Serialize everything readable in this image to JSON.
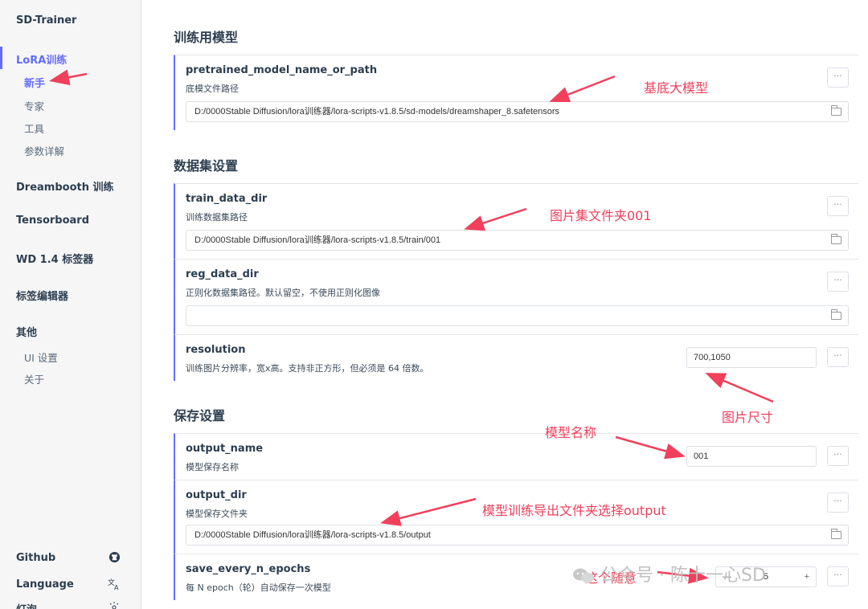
{
  "sidebar": {
    "app_title": "SD-Trainer",
    "lora_group": "LoRA训练",
    "lora_items": [
      "新手",
      "专家",
      "工具",
      "参数详解"
    ],
    "groups": [
      "Dreambooth 训练",
      "Tensorboard",
      "WD 1.4 标签器",
      "标签编辑器",
      "其他"
    ],
    "other_items": [
      "UI 设置",
      "关于"
    ],
    "bottom": [
      {
        "label": "Github",
        "icon": "github-icon"
      },
      {
        "label": "Language",
        "icon": "translate-icon"
      },
      {
        "label": "灯泡",
        "icon": "sun-icon"
      }
    ]
  },
  "sections": {
    "model": "训练用模型",
    "dataset": "数据集设置",
    "save": "保存设置"
  },
  "fields": {
    "pretrained": {
      "name": "pretrained_model_name_or_path",
      "desc": "底模文件路径",
      "value": "D:/0000Stable Diffusion/lora训练器/lora-scripts-v1.8.5/sd-models/dreamshaper_8.safetensors"
    },
    "train_data_dir": {
      "name": "train_data_dir",
      "desc": "训练数据集路径",
      "value": "D:/0000Stable Diffusion/lora训练器/lora-scripts-v1.8.5/train/001"
    },
    "reg_data_dir": {
      "name": "reg_data_dir",
      "desc": "正则化数据集路径。默认留空，不使用正则化图像",
      "value": ""
    },
    "resolution": {
      "name": "resolution",
      "desc": "训练图片分辨率，宽x高。支持非正方形，但必须是 64 倍数。",
      "value": "700,1050"
    },
    "output_name": {
      "name": "output_name",
      "desc": "模型保存名称",
      "value": "001"
    },
    "output_dir": {
      "name": "output_dir",
      "desc": "模型保存文件夹",
      "value": "D:/0000Stable Diffusion/lora训练器/lora-scripts-v1.8.5/output"
    },
    "save_every_n_epochs": {
      "name": "save_every_n_epochs",
      "desc": "每 N epoch（轮）自动保存一次模型",
      "value": "5",
      "minus": "—",
      "plus": "+"
    }
  },
  "more_label": "···",
  "annotations": {
    "base_model": "基底大模型",
    "image_folder": "图片集文件夹001",
    "image_size": "图片尺寸",
    "model_name": "模型名称",
    "output_folder": "模型训练导出文件夹选择output",
    "random": "这个随意"
  },
  "watermark": {
    "text": "公众号 · 陈十一心SD"
  },
  "colors": {
    "accent": "#646cff",
    "annotation": "#f0405b"
  }
}
